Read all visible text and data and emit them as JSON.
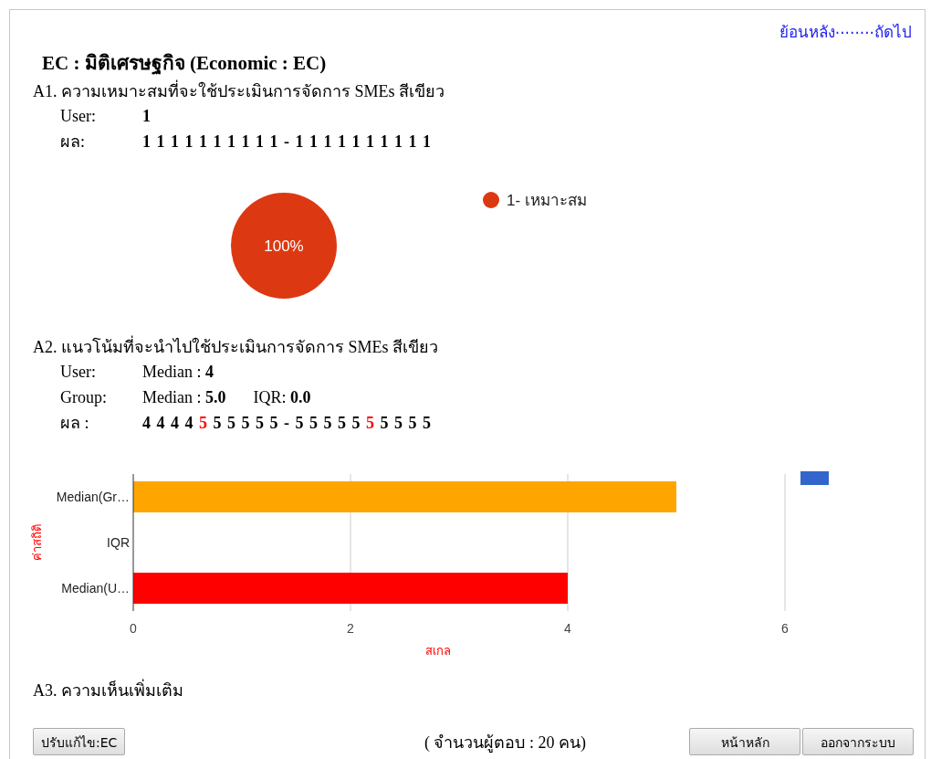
{
  "nav": {
    "back": "ย้อนหลัง",
    "separator": "........",
    "next": "ถัดไป"
  },
  "heading": "EC : มิติเศรษฐกิจ (Economic : EC)",
  "questions": [
    {
      "kind": "choice",
      "title": "A1. ความเหมาะสมที่จะใช้ประเมินการจัดการ SMEs สีเขียว",
      "rows": [
        {
          "label": "User:",
          "values": [
            {
              "text": "1",
              "emphasis": true
            }
          ]
        }
      ],
      "result": {
        "label": "ผล:",
        "tokens": [
          {
            "text": "1",
            "highlight": false
          },
          {
            "text": "1",
            "highlight": false
          },
          {
            "text": "1",
            "highlight": false
          },
          {
            "text": "1",
            "highlight": false
          },
          {
            "text": "1",
            "highlight": false
          },
          {
            "text": "1",
            "highlight": false
          },
          {
            "text": "1",
            "highlight": false
          },
          {
            "text": "1",
            "highlight": false
          },
          {
            "text": "1",
            "highlight": false
          },
          {
            "text": "1",
            "highlight": false
          },
          {
            "text": "-",
            "highlight": false
          },
          {
            "text": "1",
            "highlight": false
          },
          {
            "text": "1",
            "highlight": false
          },
          {
            "text": "1",
            "highlight": false
          },
          {
            "text": "1",
            "highlight": false
          },
          {
            "text": "1",
            "highlight": false
          },
          {
            "text": "1",
            "highlight": false
          },
          {
            "text": "1",
            "highlight": false
          },
          {
            "text": "1",
            "highlight": false
          },
          {
            "text": "1",
            "highlight": false
          },
          {
            "text": "1",
            "highlight": false
          }
        ]
      },
      "chart_data": {
        "type": "pie",
        "categories": [
          "1- เหมาะสม"
        ],
        "values": [
          100
        ],
        "colors": [
          "#dc3912"
        ],
        "value_labels": [
          "100%"
        ]
      }
    },
    {
      "kind": "scale",
      "title": "A2. แนวโน้มที่จะนำไปใช้ประเมินการจัดการ SMEs สีเขียว",
      "rows": [
        {
          "label": "User:",
          "values": [
            {
              "text": "Median : **4**",
              "emphasis": false
            }
          ]
        },
        {
          "label": "Group:",
          "values": [
            {
              "text": "Median : **5.0**",
              "emphasis": false
            },
            {
              "text": "IQR: **0.0**",
              "emphasis": false
            }
          ]
        }
      ],
      "result": {
        "label": "ผล :",
        "tokens": [
          {
            "text": "4",
            "highlight": false
          },
          {
            "text": "4",
            "highlight": false
          },
          {
            "text": "4",
            "highlight": false
          },
          {
            "text": "4",
            "highlight": false
          },
          {
            "text": "5",
            "highlight": true
          },
          {
            "text": "5",
            "highlight": false
          },
          {
            "text": "5",
            "highlight": false
          },
          {
            "text": "5",
            "highlight": false
          },
          {
            "text": "5",
            "highlight": false
          },
          {
            "text": "5",
            "highlight": false
          },
          {
            "text": "-",
            "highlight": false
          },
          {
            "text": "5",
            "highlight": false
          },
          {
            "text": "5",
            "highlight": false
          },
          {
            "text": "5",
            "highlight": false
          },
          {
            "text": "5",
            "highlight": false
          },
          {
            "text": "5",
            "highlight": false
          },
          {
            "text": "5",
            "highlight": true
          },
          {
            "text": "5",
            "highlight": false
          },
          {
            "text": "5",
            "highlight": false
          },
          {
            "text": "5",
            "highlight": false
          },
          {
            "text": "5",
            "highlight": false
          }
        ]
      },
      "chart_data": {
        "type": "bar",
        "orientation": "horizontal",
        "categories": [
          "Median(Gr…",
          "IQR",
          "Median(U…"
        ],
        "series": [
          {
            "color": "#ffa500",
            "values": [
              5,
              0,
              null
            ]
          },
          {
            "color": "#ff0000",
            "values": [
              null,
              null,
              4
            ]
          }
        ],
        "xlabel": "สเกล",
        "ylabel": "ค่าสถิติ",
        "xlim": [
          0,
          6
        ],
        "xticks": [
          0,
          2,
          4,
          6
        ]
      }
    },
    {
      "kind": "comment",
      "title": "A3. ความเห็นเพิ่มเติม"
    }
  ],
  "footer": {
    "edit_button": "ปรับแก้ไข:EC",
    "respondents": "( จำนวนผู้ตอบ : 20 คน)",
    "buttons": [
      "หน้าหลัก",
      "ออกจากระบบ"
    ]
  }
}
